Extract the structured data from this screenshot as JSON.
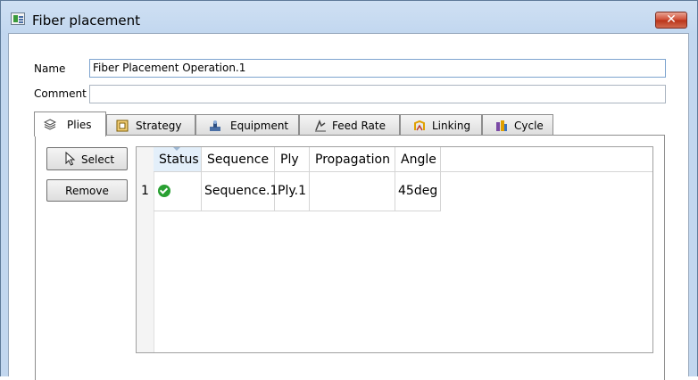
{
  "window": {
    "title": "Fiber placement",
    "close_label": "✕"
  },
  "form": {
    "name_label": "Name",
    "name_value": "Fiber Placement Operation.1",
    "comment_label": "Comment",
    "comment_value": ""
  },
  "tabs": [
    {
      "label": "Plies",
      "icon": "layers-icon",
      "active": true
    },
    {
      "label": "Strategy",
      "icon": "strategy-icon"
    },
    {
      "label": "Equipment",
      "icon": "equipment-icon"
    },
    {
      "label": "Feed Rate",
      "icon": "feed-rate-icon"
    },
    {
      "label": "Linking",
      "icon": "linking-icon"
    },
    {
      "label": "Cycle",
      "icon": "cycle-icon"
    }
  ],
  "buttons": {
    "select_label": "Select",
    "remove_label": "Remove"
  },
  "table": {
    "columns": [
      "Status",
      "Sequence",
      "Ply",
      "Propagation",
      "Angle"
    ],
    "rows": [
      {
        "index": "1",
        "status": "ok",
        "sequence": "Sequence.1",
        "ply": "Ply.1",
        "propagation": "",
        "angle": "45deg"
      }
    ]
  },
  "colors": {
    "status_ok": "#29a032",
    "selected_header": "#e3effa",
    "title_gradient": "#c2d7ef"
  }
}
